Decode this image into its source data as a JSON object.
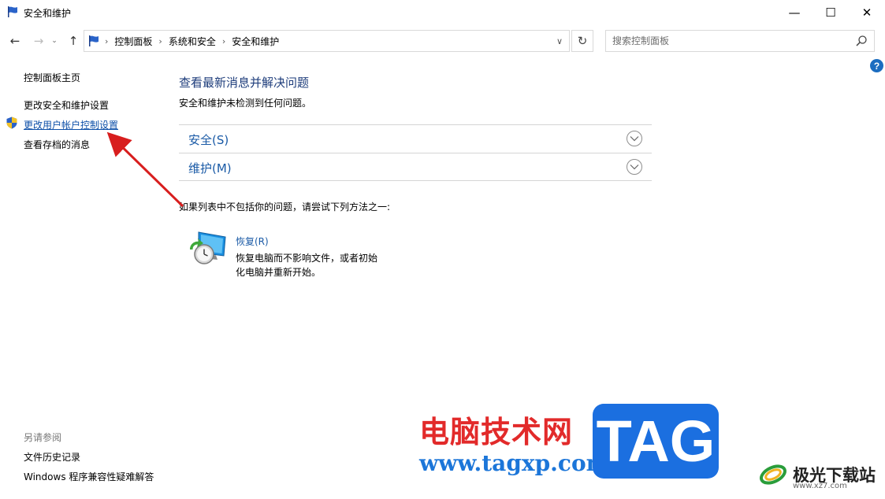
{
  "window": {
    "title": "安全和维护",
    "min_glyph": "—",
    "max_glyph": "☐",
    "close_glyph": "✕"
  },
  "nav": {
    "back_glyph": "←",
    "forward_glyph": "→",
    "recent_glyph": "⌄",
    "up_glyph": "↑",
    "refresh_glyph": "↻",
    "dropdown_glyph": "∨",
    "crumb_sep": "›",
    "breadcrumbs": [
      "控制面板",
      "系统和安全",
      "安全和维护"
    ],
    "search_placeholder": "搜索控制面板"
  },
  "help": {
    "glyph": "?"
  },
  "sidebar": {
    "items": [
      {
        "label": "控制面板主页"
      },
      {
        "label": "更改安全和维护设置"
      },
      {
        "label": "更改用户帐户控制设置"
      },
      {
        "label": "查看存档的消息"
      }
    ],
    "see_also_title": "另请参阅",
    "see_also": [
      {
        "label": "文件历史记录"
      },
      {
        "label": "Windows 程序兼容性疑难解答"
      }
    ]
  },
  "main": {
    "heading": "查看最新消息并解决问题",
    "status": "安全和维护未检测到任何问题。",
    "sections": [
      {
        "label": "安全(S)"
      },
      {
        "label": "维护(M)"
      }
    ],
    "hint": "如果列表中不包括你的问题，请尝试下列方法之一:",
    "recovery": {
      "title": "恢复(R)",
      "description": "恢复电脑而不影响文件，或者初始化电脑并重新开始。"
    }
  },
  "watermark": {
    "cn_text": "电脑技术网",
    "url": "www.tagxp.com",
    "tag": "TAG",
    "site_name": "极光下载站",
    "site_url": "www.xz7.com"
  },
  "colors": {
    "link_blue": "#1a5aa6",
    "heading_blue": "#1e3d7b",
    "arrow_red": "#d81e1e",
    "tag_blue": "#1b6fe0"
  }
}
